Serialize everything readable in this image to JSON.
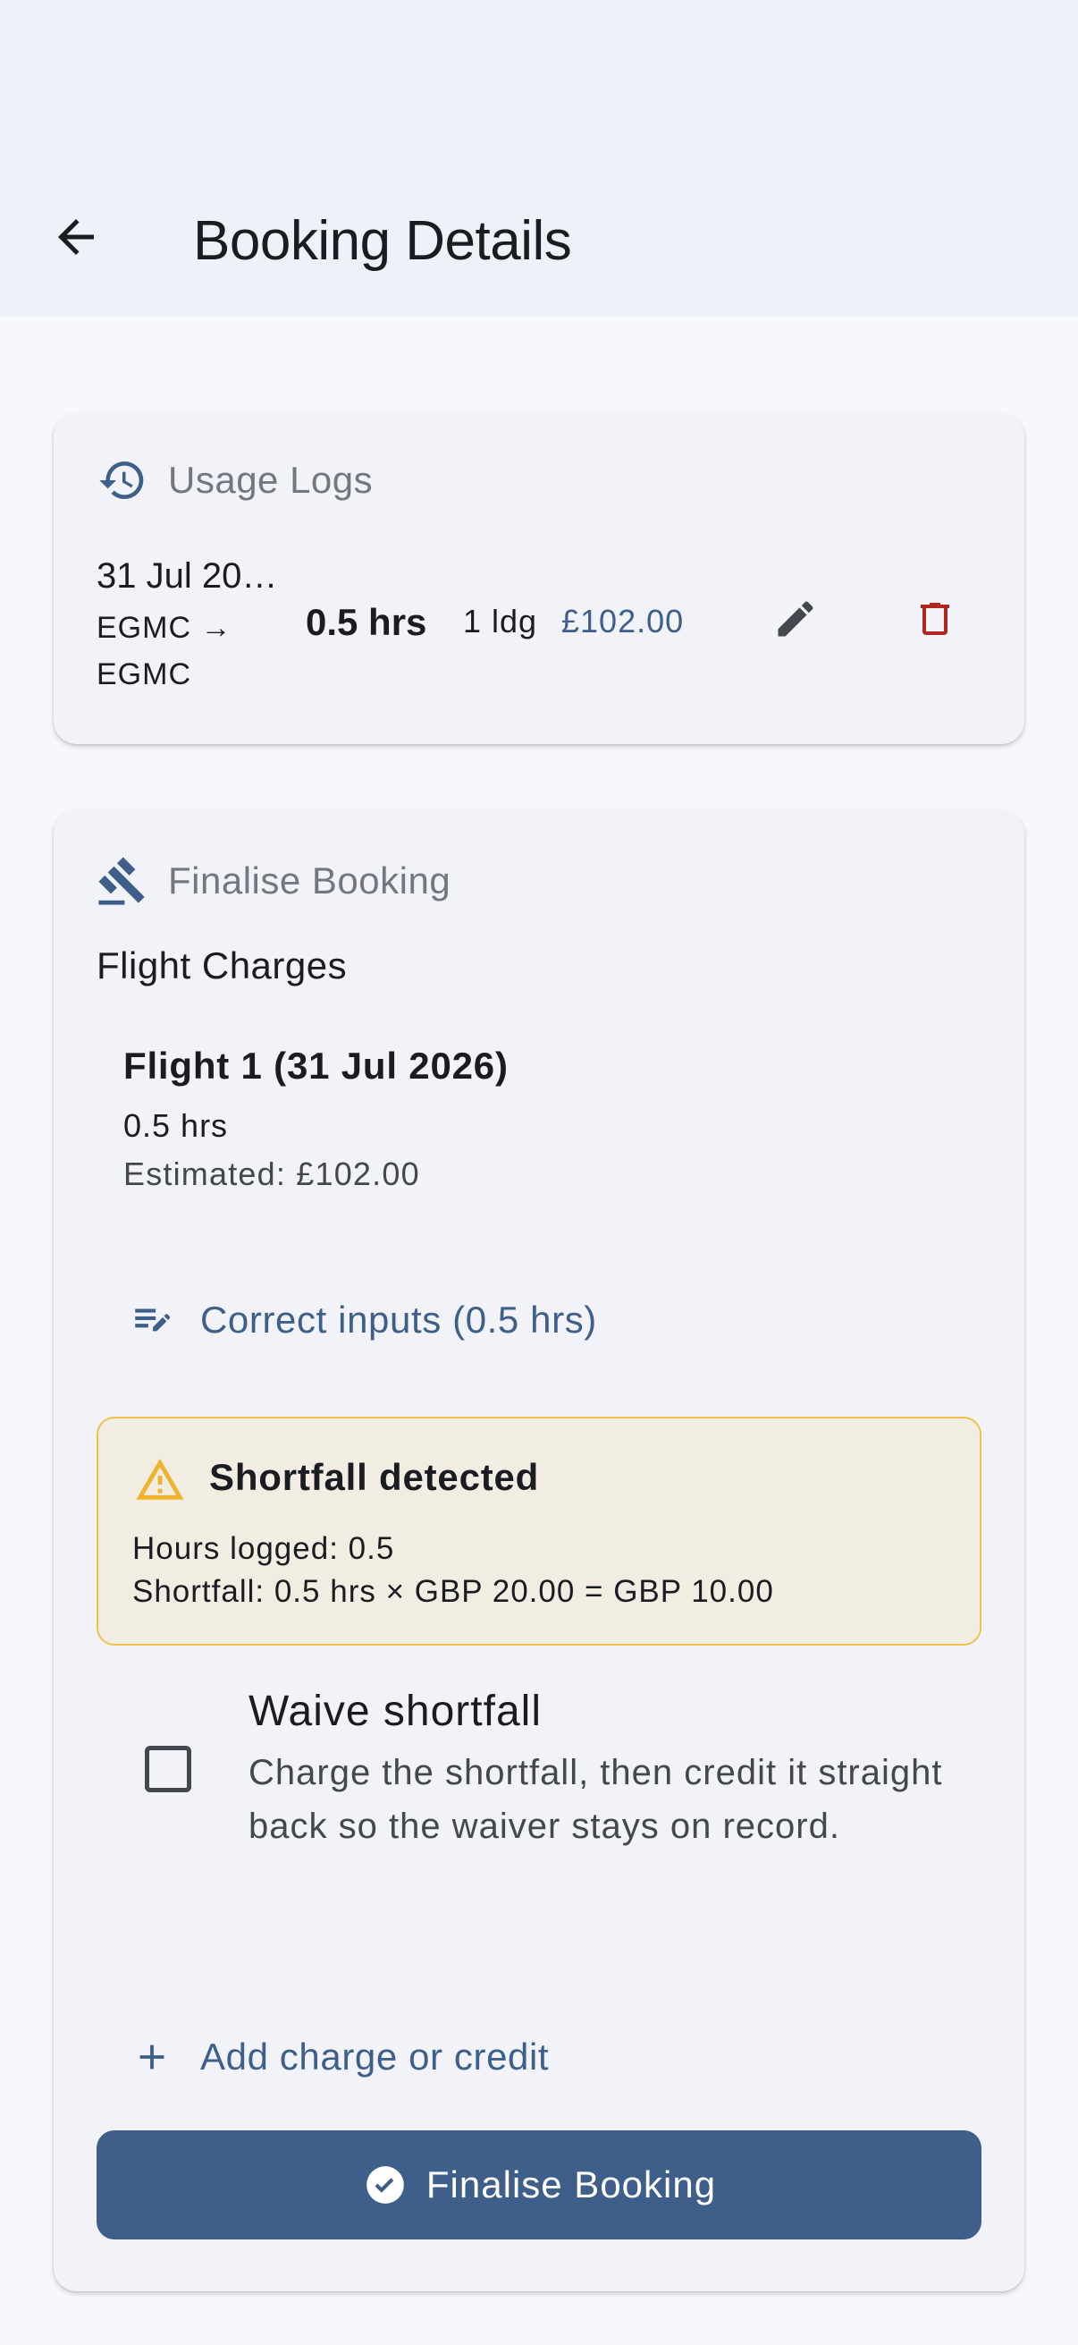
{
  "header": {
    "title": "Booking Details",
    "back_icon": "arrow-back-icon"
  },
  "usage_logs": {
    "heading": "Usage Logs",
    "heading_icon": "history-icon",
    "entries": [
      {
        "date": "31 Jul 20…",
        "route": "EGMC → EGMC",
        "hours": "0.5 hrs",
        "landings": "1 ldg",
        "price": "£102.00",
        "edit_icon": "pencil-icon",
        "delete_icon": "trash-icon"
      }
    ]
  },
  "finalise": {
    "heading": "Finalise Booking",
    "heading_icon": "gavel-icon",
    "section_label": "Flight Charges",
    "flights": [
      {
        "title": "Flight 1 (31 Jul 2026)",
        "hours": "0.5 hrs",
        "estimated": "Estimated: £102.00"
      }
    ],
    "correct_inputs_label": "Correct inputs (0.5 hrs)",
    "warning": {
      "title": "Shortfall detected",
      "line1": "Hours logged: 0.5",
      "line2": "Shortfall: 0.5 hrs × GBP 20.00 = GBP 10.00"
    },
    "waive": {
      "title": "Waive shortfall",
      "description": "Charge the shortfall, then credit it straight back so the waiver stays on record.",
      "checked": false
    },
    "add_charge_label": "Add charge or credit",
    "submit_label": "Finalise Booking"
  },
  "colors": {
    "primary": "#3d5f8a",
    "danger": "#b3261e",
    "warning_border": "#efc24a",
    "warning_bg": "#f2ede2"
  }
}
